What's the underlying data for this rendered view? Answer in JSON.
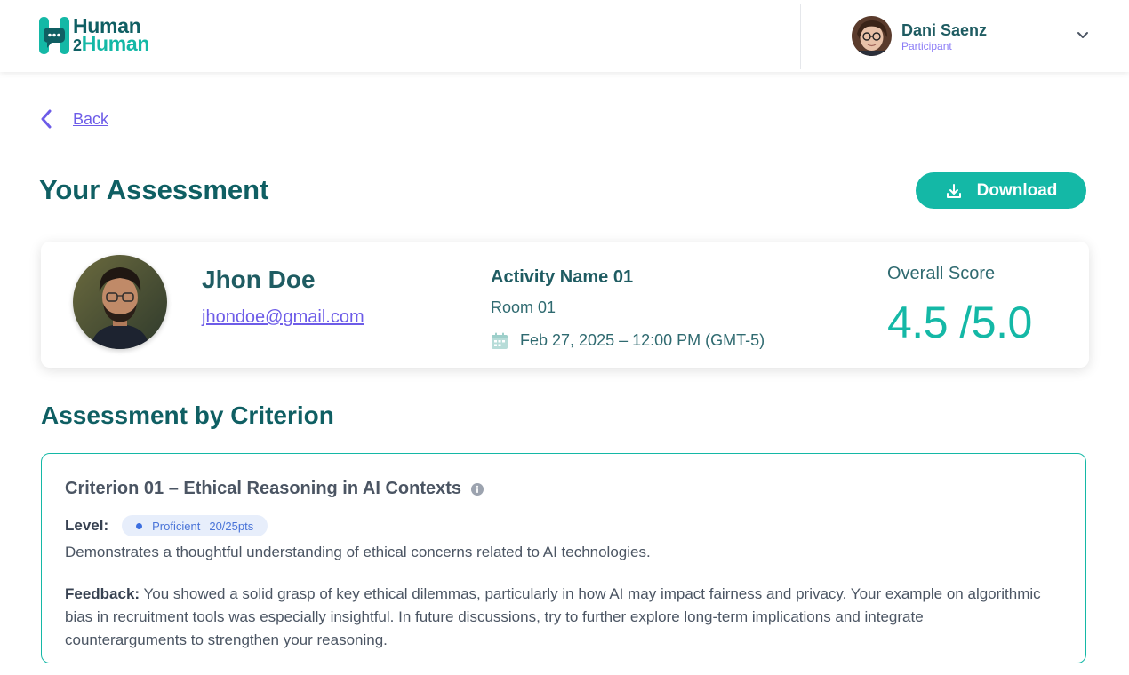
{
  "brand": {
    "line1": "Human",
    "line2_prefix": "2",
    "line2": "Human"
  },
  "user": {
    "name": "Dani Saenz",
    "role": "Participant"
  },
  "nav": {
    "back_label": "Back"
  },
  "page": {
    "title": "Your Assessment",
    "download_label": "Download"
  },
  "participant": {
    "name": "Jhon Doe",
    "email": "jhondoe@gmail.com"
  },
  "activity": {
    "name": "Activity Name 01",
    "room": "Room 01",
    "datetime": "Feb 27, 2025 – 12:00 PM (GMT-5)"
  },
  "score": {
    "label": "Overall Score",
    "value": "4.5 /5.0"
  },
  "criteria_section": {
    "title": "Assessment by Criterion"
  },
  "criterion": {
    "title": "Criterion 01 – Ethical Reasoning in AI Contexts",
    "level_label": "Level:",
    "level_name": "Proficient",
    "level_points": "20/25pts",
    "description": "Demonstrates a thoughtful understanding of ethical concerns related to AI technologies.",
    "feedback_label": "Feedback:",
    "feedback_text": " You showed a solid grasp of key ethical dilemmas, particularly in how AI may impact fairness and privacy. Your example on algorithmic bias in recruitment tools was especially insightful. In future discussions, try to further explore long-term implications and integrate counterarguments to strengthen your reasoning."
  },
  "colors": {
    "brand_dark": "#0f5f63",
    "brand_teal": "#14b8a6",
    "link_purple": "#6d5ce8",
    "badge_bg": "#e7eefb",
    "badge_text": "#4a74d8"
  },
  "icons": {
    "logo": "chat-bubble-h-logo",
    "chevron": "chevron-down-icon",
    "back": "chevron-left-icon",
    "download": "download-icon",
    "calendar": "calendar-icon",
    "info": "info-icon"
  }
}
